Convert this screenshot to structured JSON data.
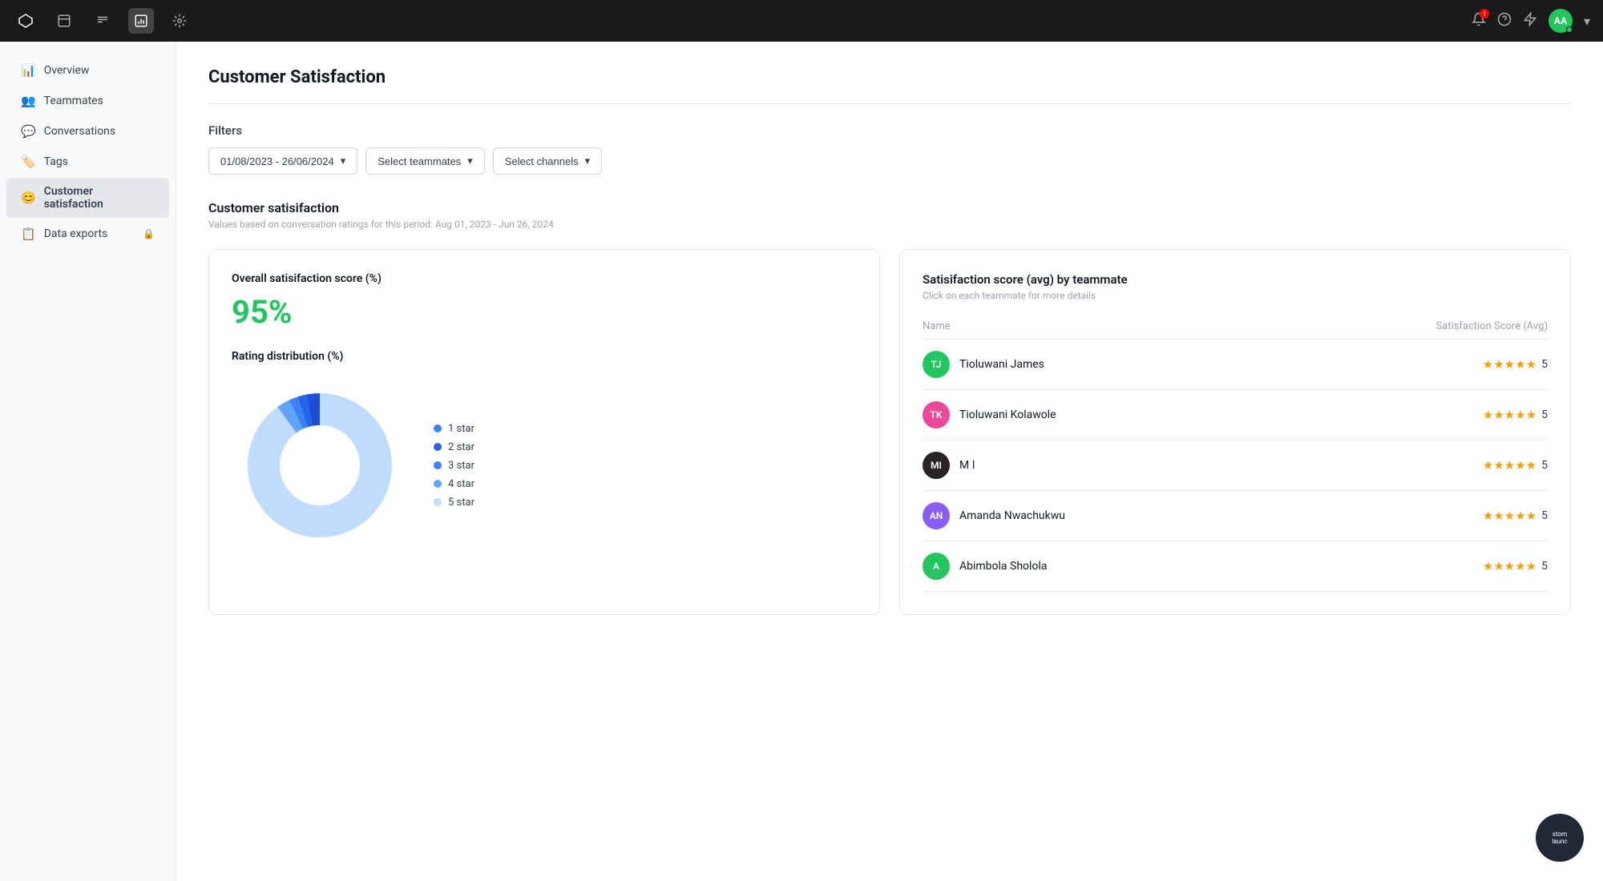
{
  "topnav": {
    "icons": [
      "chat-icon",
      "inbox-icon",
      "reports-icon",
      "settings-icon"
    ],
    "right_icons": [
      "bell-icon",
      "help-icon",
      "bolt-icon"
    ],
    "avatar_initials": "AA",
    "bell_badge": "1"
  },
  "sidebar": {
    "items": [
      {
        "id": "overview",
        "label": "Overview",
        "icon": "📊"
      },
      {
        "id": "teammates",
        "label": "Teammates",
        "icon": "👥"
      },
      {
        "id": "conversations",
        "label": "Conversations",
        "icon": "💬"
      },
      {
        "id": "tags",
        "label": "Tags",
        "icon": "🏷️"
      },
      {
        "id": "customer-satisfaction",
        "label": "Customer satisfaction",
        "icon": "😊",
        "active": true
      },
      {
        "id": "data-exports",
        "label": "Data exports",
        "icon": "📋",
        "locked": true
      }
    ]
  },
  "page": {
    "title": "Customer Satisfaction",
    "filters_label": "Filters",
    "date_range": "01/08/2023 - 26/06/2024",
    "select_teammates": "Select teammates",
    "select_channels": "Select channels",
    "section_title": "Customer satisifaction",
    "section_subtitle": "Values based on conversation ratings for this period: Aug 01, 2023 - Jun 26, 2024",
    "overall_label": "Overall satisifaction score (%)",
    "overall_score": "95%",
    "rating_dist_label": "Rating distribution (%)",
    "right_card_title": "Satisifaction score (avg) by teammate",
    "right_card_subtitle": "Click on each teammate for more details",
    "table_col_name": "Name",
    "table_col_score": "Satisfaction Score (Avg)"
  },
  "chart": {
    "segments": [
      {
        "label": "1 star",
        "color": "#3b82f6",
        "pct": 3
      },
      {
        "label": "2 star",
        "color": "#2563eb",
        "pct": 2
      },
      {
        "label": "3 star",
        "color": "#1d4ed8",
        "pct": 2
      },
      {
        "label": "4 star",
        "color": "#60a5fa",
        "pct": 3
      },
      {
        "label": "5 star",
        "color": "#bfdbfe",
        "pct": 90
      }
    ]
  },
  "teammates": [
    {
      "initials": "TJ",
      "name": "Tioluwani James",
      "bg": "#22c55e",
      "score": 5
    },
    {
      "initials": "TK",
      "name": "Tioluwani Kolawole",
      "bg": "#ec4899",
      "score": 5
    },
    {
      "initials": "MI",
      "name": "M I",
      "bg": "#292524",
      "score": 5
    },
    {
      "initials": "AN",
      "name": "Amanda Nwachukwu",
      "bg": "#8b5cf6",
      "score": 5
    },
    {
      "initials": "A",
      "name": "Abimbola Sholola",
      "bg": "#22c55e",
      "score": 5
    }
  ],
  "widget": {
    "line1": "stom",
    "line2": "launc"
  }
}
